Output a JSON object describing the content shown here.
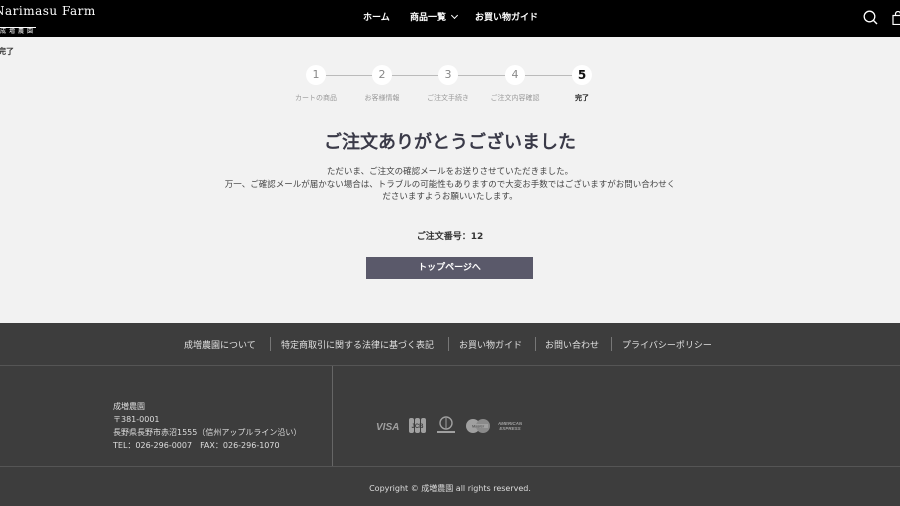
{
  "header": {
    "logo_main": "Narimasu Farm",
    "logo_sub": "成増農園",
    "nav": [
      {
        "label": "ホーム"
      },
      {
        "label": "商品一覧"
      },
      {
        "label": "お買い物ガイド"
      }
    ],
    "search_icon": "search-icon",
    "bag_icon": "shopping-bag-icon"
  },
  "page_label": "完了",
  "steps": [
    {
      "num": "1",
      "label": "カートの商品"
    },
    {
      "num": "2",
      "label": "お客様情報"
    },
    {
      "num": "3",
      "label": "ご注文手続き"
    },
    {
      "num": "4",
      "label": "ご注文内容確認"
    },
    {
      "num": "5",
      "label": "完了",
      "active": true
    }
  ],
  "main": {
    "title": "ご注文ありがとうございました",
    "message_line1": "ただいま、ご注文の確認メールをお送りさせていただきました。",
    "message_line2": "万一、ご確認メールが届かない場合は、トラブルの可能性もありますので大変お手数ではございますがお問い合わせく",
    "message_line3": "ださいますようお願いいたします。",
    "order_number": "ご注文番号：12",
    "top_button": "トップページへ"
  },
  "footer": {
    "links": [
      {
        "label": "成増農園について"
      },
      {
        "label": "特定商取引に関する法律に基づく表記"
      },
      {
        "label": "お買い物ガイド"
      },
      {
        "label": "お問い合わせ"
      },
      {
        "label": "プライバシーポリシー"
      }
    ],
    "address": {
      "name": "成増農園",
      "zip": "〒381-0001",
      "address": "長野県長野市赤沼1555（信州アップルライン沿い）",
      "tel_fax": "TEL：026-296-0007　FAX：026-296-1070"
    },
    "cards": [
      {
        "name": "VISA",
        "icon": "visa-icon"
      },
      {
        "name": "JCB",
        "icon": "jcb-icon"
      },
      {
        "name": "Diners Club",
        "icon": "diners-club-icon"
      },
      {
        "name": "Mastercard",
        "icon": "mastercard-icon"
      },
      {
        "name": "American Express",
        "icon": "amex-icon"
      }
    ],
    "copyright": "Copyright © 成増農園 all rights reserved."
  }
}
